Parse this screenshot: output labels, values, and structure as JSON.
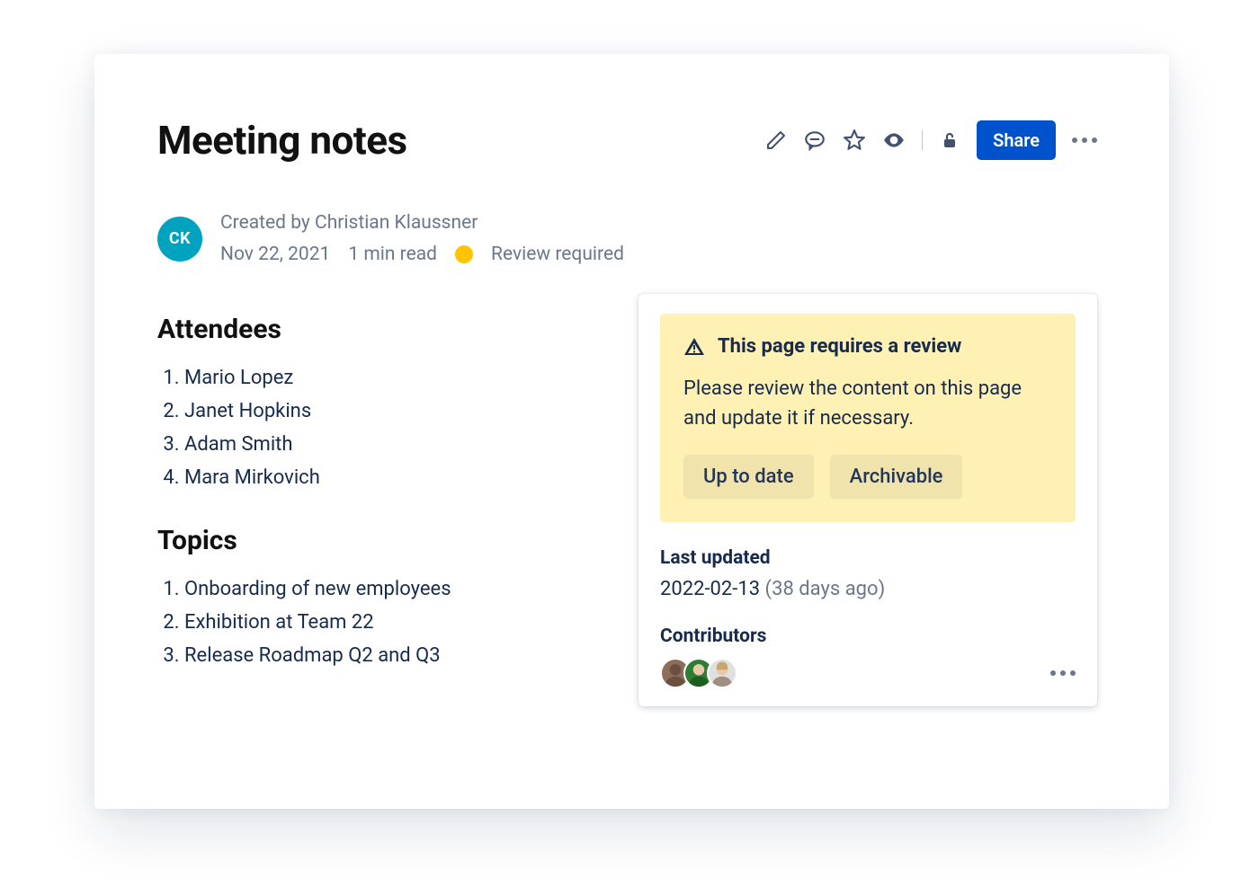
{
  "page": {
    "title": "Meeting notes"
  },
  "toolbar": {
    "share_label": "Share"
  },
  "meta": {
    "avatar_initials": "CK",
    "created_by_label": "Created by Christian Klaussner",
    "date": "Nov 22, 2021",
    "read_time": "1 min read",
    "status_text": "Review required"
  },
  "sections": {
    "attendees_heading": "Attendees",
    "attendees": [
      "Mario Lopez",
      "Janet Hopkins",
      "Adam Smith",
      "Mara Mirkovich"
    ],
    "topics_heading": "Topics",
    "topics": [
      "Onboarding of new employees",
      "Exhibition at Team 22",
      "Release Roadmap Q2 and Q3"
    ]
  },
  "panel": {
    "alert_title": "This page requires a review",
    "alert_body": "Please review the content on this page and update it if necessary.",
    "btn_uptodate": "Up to date",
    "btn_archivable": "Archivable",
    "last_updated_heading": "Last updated",
    "last_updated_date": "2022-02-13",
    "last_updated_ago": "(38 days ago)",
    "contributors_heading": "Contributors"
  }
}
